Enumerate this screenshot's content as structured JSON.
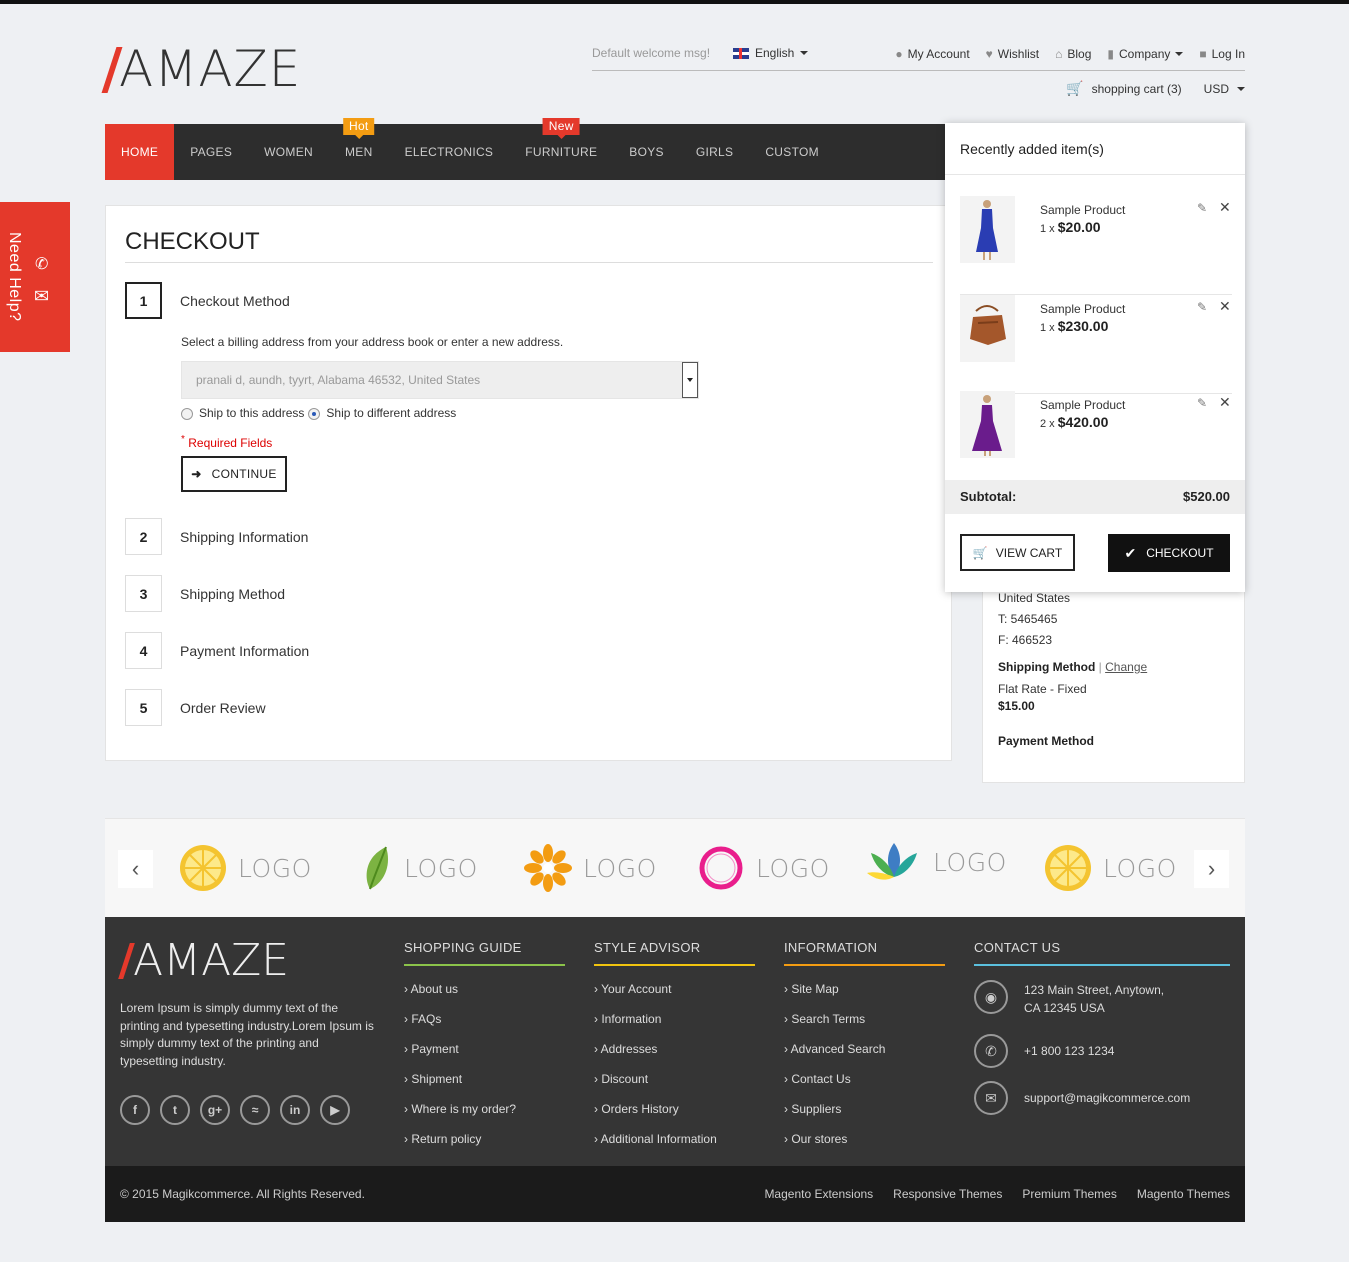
{
  "header": {
    "logo_text": "AMAZE",
    "welcome": "Default welcome msg!",
    "language": "English",
    "top_links": [
      "My Account",
      "Wishlist",
      "Blog",
      "Company",
      "Log In"
    ],
    "cart_link": "shopping cart (3)",
    "currency": "USD"
  },
  "nav": {
    "items": [
      "HOME",
      "PAGES",
      "WOMEN",
      "MEN",
      "ELECTRONICS",
      "FURNITURE",
      "BOYS",
      "GIRLS",
      "CUSTOM"
    ],
    "badges": {
      "men": "Hot",
      "furniture": "New"
    }
  },
  "help": {
    "label": "Need Help?"
  },
  "checkout": {
    "title": "CHECKOUT",
    "steps": [
      {
        "num": "1",
        "title": "Checkout Method"
      },
      {
        "num": "2",
        "title": "Shipping Information"
      },
      {
        "num": "3",
        "title": "Shipping Method"
      },
      {
        "num": "4",
        "title": "Payment Information"
      },
      {
        "num": "5",
        "title": "Order Review"
      }
    ],
    "billing_note": "Select a billing address from your address book or enter a new address.",
    "address_selected": "pranali d, aundh, tyyrt, Alabama 46532, United States",
    "radio_ship_same": "Ship to this address",
    "radio_ship_diff": "Ship to different address",
    "required": "Required Fields",
    "continue": "CONTINUE"
  },
  "sidebar": {
    "country": "United States",
    "tel": "T: 5465465",
    "fax": "F: 466523",
    "shipping_method_label": "Shipping Method",
    "change": "Change",
    "shipping_rate": "Flat Rate - Fixed",
    "shipping_price": "$15.00",
    "payment_method_label": "Payment Method"
  },
  "cart_popup": {
    "title": "Recently added item(s)",
    "items": [
      {
        "name": "Sample Product",
        "qty": "1",
        "price": "$20.00"
      },
      {
        "name": "Sample Product",
        "qty": "1",
        "price": "$230.00"
      },
      {
        "name": "Sample Product",
        "qty": "2",
        "price": "$420.00"
      }
    ],
    "subtotal_label": "Subtotal:",
    "subtotal_value": "$520.00",
    "view_cart": "VIEW CART",
    "checkout": "CHECKOUT"
  },
  "brands": {
    "word": "LOGO"
  },
  "footer": {
    "logo_text": "AMAZE",
    "description": "Lorem Ipsum is simply dummy text of the printing and typesetting industry.Lorem Ipsum is simply dummy text of the printing and typesetting industry.",
    "columns": [
      {
        "heading": "SHOPPING GUIDE",
        "color": "#8bc34a",
        "links": [
          "About us",
          "FAQs",
          "Payment",
          "Shipment",
          "Where is my order?",
          "Return policy"
        ]
      },
      {
        "heading": "STYLE ADVISOR",
        "color": "#f1c40f",
        "links": [
          "Your Account",
          "Information",
          "Addresses",
          "Discount",
          "Orders History",
          "Additional Information"
        ]
      },
      {
        "heading": "INFORMATION",
        "color": "#f39c12",
        "links": [
          "Site Map",
          "Search Terms",
          "Advanced Search",
          "Contact Us",
          "Suppliers",
          "Our stores"
        ]
      }
    ],
    "contact": {
      "heading": "CONTACT US",
      "color": "#5bc0de",
      "address_line1": "123 Main Street, Anytown,",
      "address_line2": "CA 12345 USA",
      "phone": "+1 800 123 1234",
      "email": "support@magikcommerce.com"
    },
    "copyright": "© 2015 Magikcommerce. All Rights Reserved.",
    "bottom_links": [
      "Magento Extensions",
      "Responsive Themes",
      "Premium Themes",
      "Magento Themes"
    ]
  },
  "colors": {
    "accent": "#e4392b",
    "nav_bg": "#2d2d2d",
    "footer_bg": "#353535",
    "hot": "#f39c12"
  }
}
